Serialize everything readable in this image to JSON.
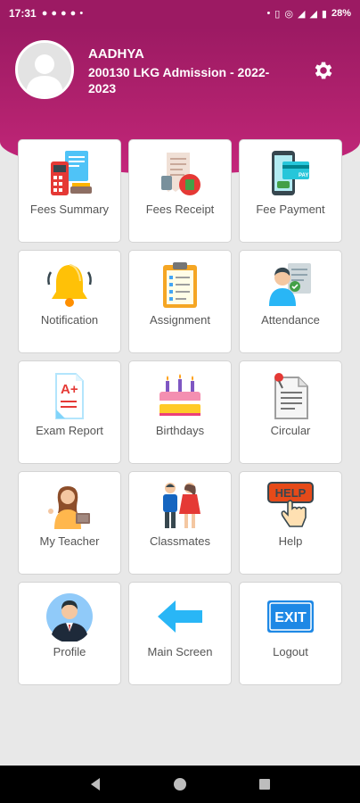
{
  "status_bar": {
    "time": "17:31",
    "battery": "28%",
    "notification_icons": [
      "chat-icon",
      "messenger-icon",
      "telegram-icon",
      "compass-icon",
      "dot-icon"
    ],
    "system_icons": [
      "location-icon",
      "vibrate-icon",
      "vowifi-icon",
      "wifi-icon",
      "signal-icon",
      "battery-icon"
    ]
  },
  "header": {
    "student_name": "AADHYA",
    "student_class": "200130 LKG Admission - 2022-2023",
    "settings_icon": "gear-icon"
  },
  "menu": [
    {
      "label": "Fees Summary",
      "icon": "fees-summary-icon"
    },
    {
      "label": "Fees Receipt",
      "icon": "fees-receipt-icon"
    },
    {
      "label": "Fee Payment",
      "icon": "fee-payment-icon"
    },
    {
      "label": "Notification",
      "icon": "bell-icon"
    },
    {
      "label": "Assignment",
      "icon": "clipboard-icon"
    },
    {
      "label": "Attendance",
      "icon": "attendance-icon"
    },
    {
      "label": "Exam Report",
      "icon": "exam-report-icon"
    },
    {
      "label": "Birthdays",
      "icon": "cake-icon"
    },
    {
      "label": "Circular",
      "icon": "circular-icon"
    },
    {
      "label": "My Teacher",
      "icon": "teacher-icon"
    },
    {
      "label": "Classmates",
      "icon": "classmates-icon"
    },
    {
      "label": "Help",
      "icon": "help-icon"
    },
    {
      "label": "Profile",
      "icon": "profile-icon"
    },
    {
      "label": "Main Screen",
      "icon": "back-arrow-icon"
    },
    {
      "label": "Logout",
      "icon": "exit-icon"
    }
  ],
  "help_sign_text": "HELP",
  "exit_sign_text": "EXIT",
  "exam_grade_text": "A+",
  "theme": {
    "primary": "#9c1a63",
    "background": "#e8e8e8",
    "label": "#555555"
  }
}
